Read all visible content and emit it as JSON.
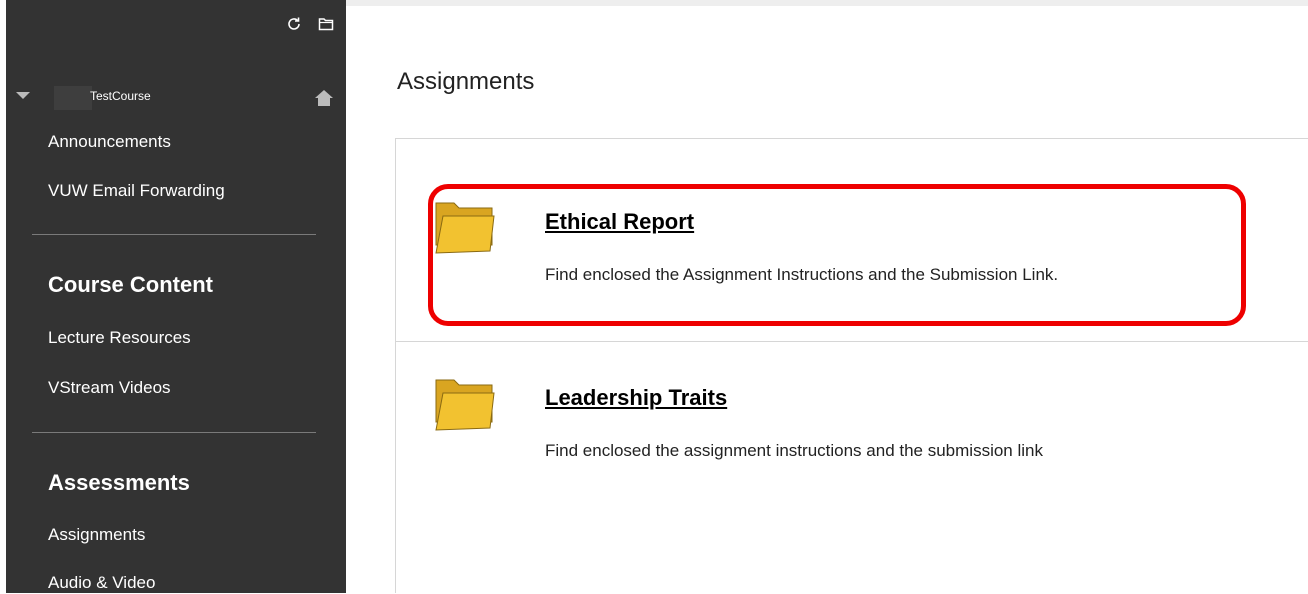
{
  "sidebar": {
    "course_name": "TestCourse",
    "links_top": [
      "Announcements",
      "VUW Email Forwarding"
    ],
    "course_content": {
      "heading": "Course Content",
      "links": [
        "Lecture Resources",
        "VStream Videos"
      ]
    },
    "assessments": {
      "heading": "Assessments",
      "links": [
        "Assignments",
        "Audio & Video"
      ]
    },
    "icons": [
      "refresh-icon",
      "folder-view-icon",
      "collapse-arrow-icon",
      "home-icon"
    ]
  },
  "main": {
    "title": "Assignments",
    "items": [
      {
        "title": "Ethical Report",
        "description": "Find enclosed the Assignment Instructions and the Submission Link.",
        "icon": "folder-icon"
      },
      {
        "title": "Leadership Traits",
        "description": "Find enclosed the assignment instructions and the submission link",
        "icon": "folder-icon"
      }
    ]
  },
  "colors": {
    "sidebar_bg": "#333333",
    "highlight": "#ee0000",
    "folder_fill": "#f2c230"
  }
}
